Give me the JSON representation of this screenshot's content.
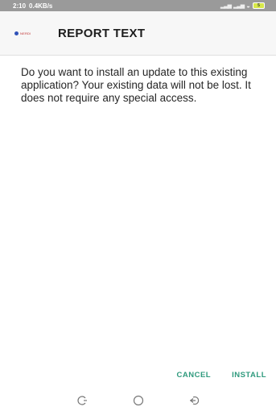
{
  "status_bar": {
    "time": "2:10",
    "speed": "0.4KB/s",
    "battery": "5",
    "icons": [
      "signal-icon",
      "signal-icon",
      "wifi-icon",
      "battery-icon"
    ]
  },
  "app_bar": {
    "logo_text": "NERDI",
    "title": "REPORT TEXT"
  },
  "message": "Do you want to install an update to this existing application? Your existing data will not be lost. It does not require any special access.",
  "actions": {
    "cancel_label": "CANCEL",
    "install_label": "INSTALL"
  },
  "nav": {
    "icons": [
      "recent-apps-icon",
      "home-icon",
      "back-icon"
    ]
  },
  "colors": {
    "status_bar": "#9a9a9a",
    "accent": "#2f9a7d",
    "title_bar": "#f7f7f7"
  }
}
